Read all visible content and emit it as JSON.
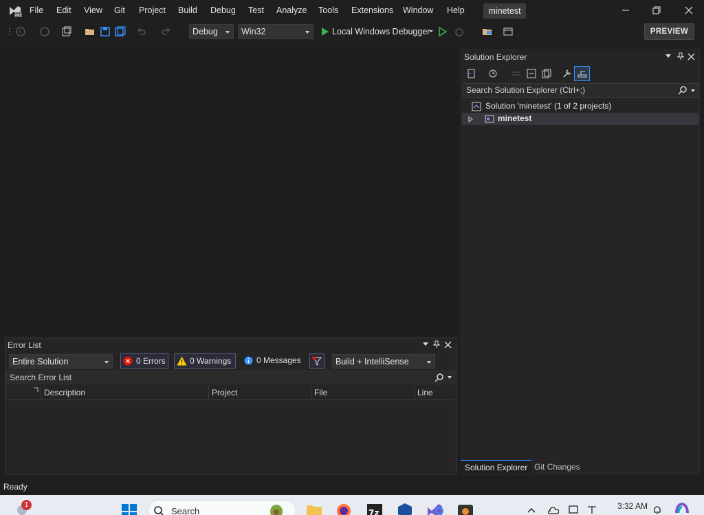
{
  "menu": {
    "items": [
      "File",
      "Edit",
      "View",
      "Git",
      "Project",
      "Build",
      "Debug",
      "Test",
      "Analyze",
      "Tools",
      "Extensions",
      "Window",
      "Help"
    ],
    "solution_name": "minetest"
  },
  "toolbar": {
    "config": "Debug",
    "platform": "Win32",
    "run_target": "Local Windows Debugger",
    "preview_label": "PREVIEW"
  },
  "solution_explorer": {
    "title": "Solution Explorer",
    "search_placeholder": "Search Solution Explorer (Ctrl+;)",
    "solution_label": "Solution 'minetest' (1 of 2 projects)",
    "project_label": "minetest",
    "tabs": [
      "Solution Explorer",
      "Git Changes"
    ]
  },
  "error_list": {
    "title": "Error List",
    "scope": "Entire Solution",
    "errors": "0 Errors",
    "warnings": "0 Warnings",
    "messages": "0 Messages",
    "build_filter": "Build + IntelliSense",
    "search_placeholder": "Search Error List",
    "columns": [
      "Description",
      "Project",
      "File",
      "Line"
    ]
  },
  "status": {
    "text": "Ready"
  },
  "taskbar": {
    "search_label": "Search",
    "notification_badge": "1",
    "time": "3:32 AM"
  },
  "colors": {
    "accent": "#0e639c",
    "run_green": "#3ab54a",
    "error_red": "#e51400",
    "warning_yellow": "#ffcc00",
    "info_blue": "#3794ff",
    "vs_purple": "#7a57c7"
  }
}
